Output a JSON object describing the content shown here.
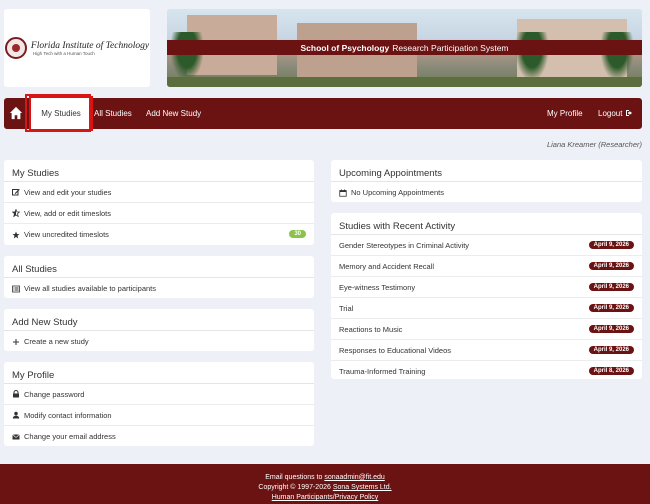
{
  "logo": {
    "name": "Florida Institute of Technology",
    "tagline": "High Tech with a Human Touch"
  },
  "banner": {
    "school": "School of Psychology",
    "system": "Research Participation System"
  },
  "nav": {
    "home_icon": "home-icon",
    "my_studies": "My Studies",
    "all_studies": "All Studies",
    "add_new_study": "Add New Study",
    "my_profile": "My Profile",
    "logout": "Logout",
    "logout_icon": "sign-out-icon"
  },
  "user": {
    "display": "Liana Kreamer (Researcher)"
  },
  "my_studies": {
    "title": "My Studies",
    "items": [
      {
        "label": "View and edit your studies",
        "icon": "edit-icon"
      },
      {
        "label": "View, add or edit timeslots",
        "icon": "star-half-icon"
      },
      {
        "label": "View uncredited timeslots",
        "icon": "star-icon",
        "badge": "30"
      }
    ]
  },
  "all_studies": {
    "title": "All Studies",
    "items": [
      {
        "label": "View all studies available to participants",
        "icon": "list-icon"
      }
    ]
  },
  "add_new_study": {
    "title": "Add New Study",
    "items": [
      {
        "label": "Create a new study",
        "icon": "plus-icon"
      }
    ]
  },
  "my_profile": {
    "title": "My Profile",
    "items": [
      {
        "label": "Change password",
        "icon": "lock-icon"
      },
      {
        "label": "Modify contact information",
        "icon": "user-icon"
      },
      {
        "label": "Change your email address",
        "icon": "envelope-icon"
      }
    ]
  },
  "upcoming": {
    "title": "Upcoming Appointments",
    "items": [
      {
        "label": "No Upcoming Appointments",
        "icon": "calendar-icon"
      }
    ]
  },
  "recent": {
    "title": "Studies with Recent Activity",
    "items": [
      {
        "label": "Gender Stereotypes in Criminal Activity",
        "date": "April 9, 2026"
      },
      {
        "label": "Memory and Accident Recall",
        "date": "April 9, 2026"
      },
      {
        "label": "Eye-witness Testimony",
        "date": "April 9, 2026"
      },
      {
        "label": "Trial",
        "date": "April 9, 2026"
      },
      {
        "label": "Reactions to Music",
        "date": "April 9, 2026"
      },
      {
        "label": "Responses to Educational Videos",
        "date": "April 9, 2026"
      },
      {
        "label": "Trauma-Informed Training",
        "date": "April 8, 2026"
      }
    ]
  },
  "footer": {
    "email_prefix": "Email questions to",
    "email": "sonaadmin@fit.edu",
    "copyright": "Copyright © 1997-2026",
    "company": "Sona Systems Ltd.",
    "policy": "Human Participants/Privacy Policy"
  },
  "colors": {
    "brand": "#6b1212",
    "badge_green": "#8bc34a",
    "highlight": "#d41818"
  }
}
